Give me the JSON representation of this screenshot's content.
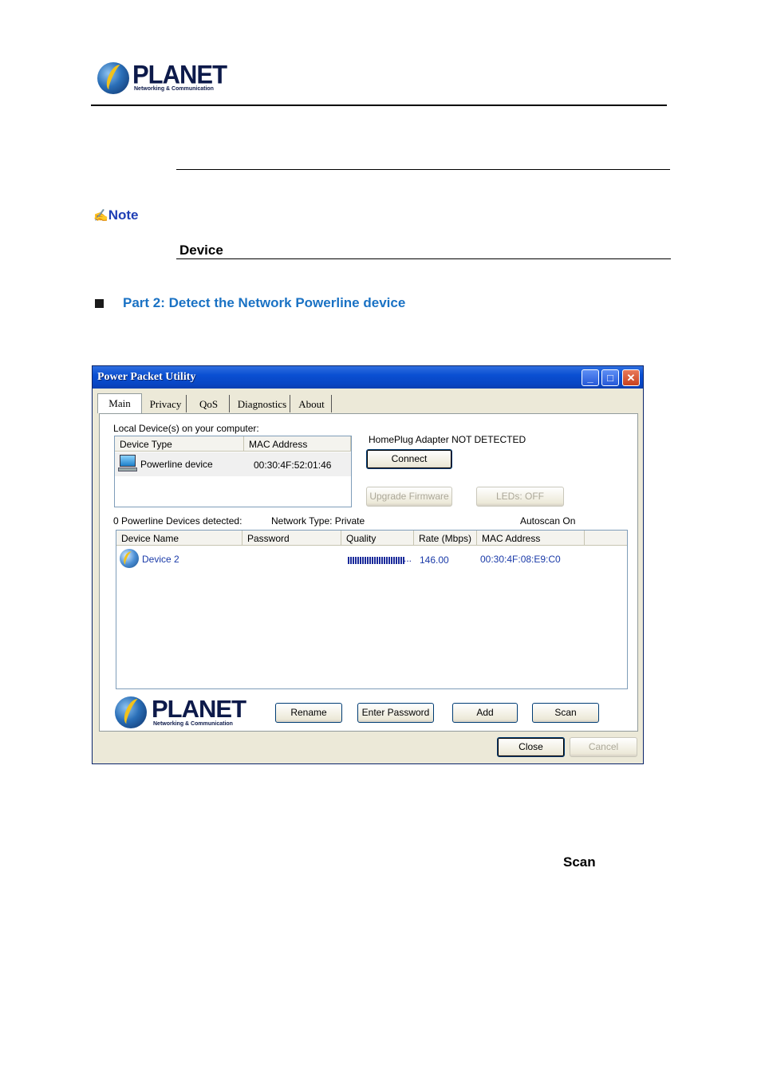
{
  "document": {
    "brand_name": "PLANET",
    "brand_tagline": "Networking & Communication",
    "note_label": "Note",
    "device_label": "Device",
    "part_title": "Part 2: Detect the Network Powerline device",
    "scan_word": "Scan"
  },
  "window": {
    "title": "Power Packet Utility",
    "tabs": [
      "Main",
      "Privacy",
      "QoS",
      "Diagnostics",
      "About"
    ],
    "active_tab": "Main",
    "local_devices_label": "Local Device(s) on your computer:",
    "local_columns": [
      "Device Type",
      "MAC Address"
    ],
    "local_rows": [
      {
        "device_type": "Powerline device",
        "mac": "00:30:4F:52:01:46"
      }
    ],
    "adapter_status": "HomePlug Adapter NOT DETECTED",
    "connect_button": "Connect",
    "upgrade_button": "Upgrade Firmware",
    "leds_button": "LEDs:  OFF",
    "devices_detected": "0 Powerline Devices detected:",
    "network_type": "Network Type: Private",
    "autoscan": "Autoscan On",
    "remote_columns": [
      "Device Name",
      "Password",
      "Quality",
      "Rate (Mbps)",
      "MAC Address"
    ],
    "remote_rows": [
      {
        "name": "Device 2",
        "password": "",
        "quality_text": "...",
        "rate": "146.00",
        "mac": "00:30:4F:08:E9:C0"
      }
    ],
    "rename_button": "Rename",
    "enter_password_button": "Enter Password",
    "add_button": "Add",
    "scan_button": "Scan",
    "close_button": "Close",
    "cancel_button": "Cancel",
    "logo_brand": "PLANET",
    "logo_tagline": "Networking & Communication"
  },
  "colors": {
    "titlebar": "#0a4fd2",
    "note": "#1f3fb5",
    "part_title": "#1a72c4",
    "device_link": "#1a3aa8"
  }
}
